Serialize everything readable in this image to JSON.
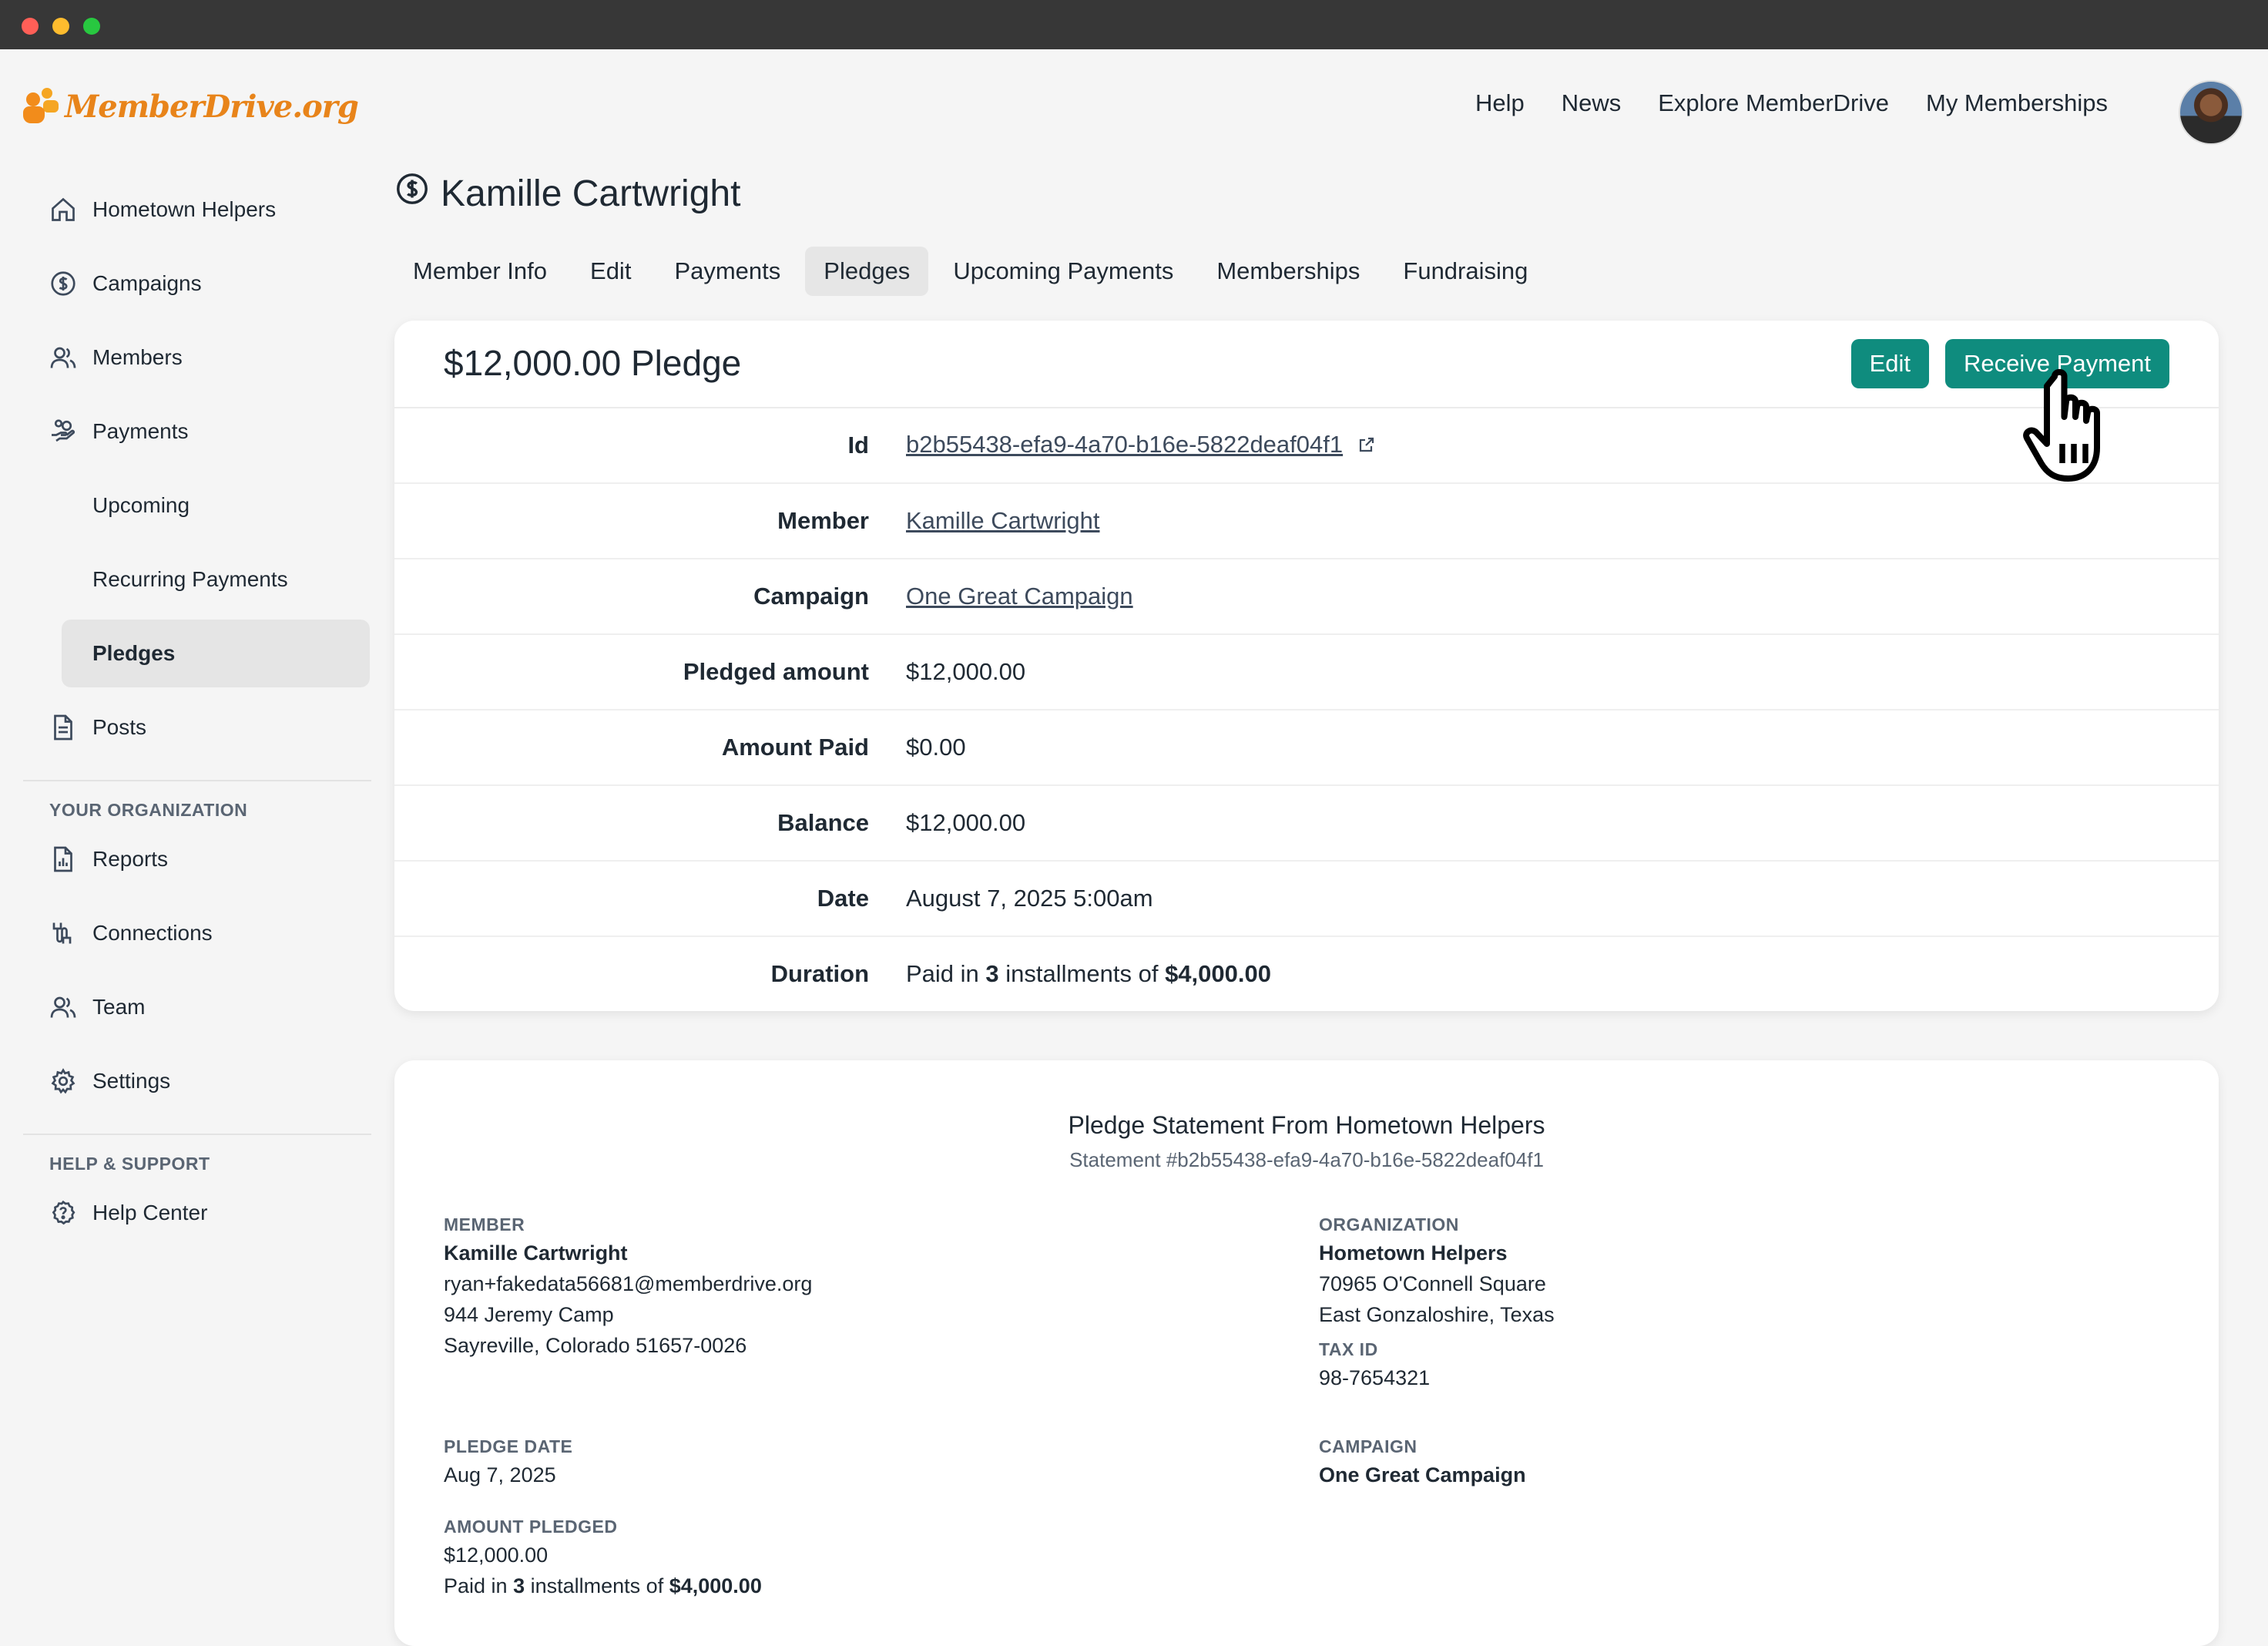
{
  "app": {
    "logo_text": "MemberDrive.org"
  },
  "topnav": {
    "items": [
      "Help",
      "News",
      "Explore MemberDrive",
      "My Memberships"
    ]
  },
  "sidebar": {
    "items": [
      {
        "label": "Hometown Helpers",
        "icon": "home-icon"
      },
      {
        "label": "Campaigns",
        "icon": "dollar-circle-icon"
      },
      {
        "label": "Members",
        "icon": "users-icon"
      },
      {
        "label": "Payments",
        "icon": "hand-coins-icon"
      },
      {
        "label": "Upcoming"
      },
      {
        "label": "Recurring Payments"
      },
      {
        "label": "Pledges"
      },
      {
        "label": "Posts",
        "icon": "document-icon"
      }
    ],
    "org_heading": "YOUR ORGANIZATION",
    "org_items": [
      {
        "label": "Reports",
        "icon": "report-icon"
      },
      {
        "label": "Connections",
        "icon": "connections-icon"
      },
      {
        "label": "Team",
        "icon": "team-icon"
      },
      {
        "label": "Settings",
        "icon": "gear-icon"
      }
    ],
    "help_heading": "HELP & SUPPORT",
    "help_items": [
      {
        "label": "Help Center",
        "icon": "question-circle-icon"
      }
    ]
  },
  "page": {
    "title": "Kamille Cartwright"
  },
  "tabs": [
    "Member Info",
    "Edit",
    "Payments",
    "Pledges",
    "Upcoming Payments",
    "Memberships",
    "Fundraising"
  ],
  "pledge": {
    "title": "$12,000.00 Pledge",
    "edit_label": "Edit",
    "receive_label": "Receive Payment",
    "fields": {
      "id_label": "Id",
      "id": "b2b55438-efa9-4a70-b16e-5822deaf04f1",
      "member_label": "Member",
      "member": "Kamille Cartwright",
      "campaign_label": "Campaign",
      "campaign": "One Great Campaign",
      "pledged_label": "Pledged amount",
      "pledged": "$12,000.00",
      "paid_label": "Amount Paid",
      "paid": "$0.00",
      "balance_label": "Balance",
      "balance": "$12,000.00",
      "date_label": "Date",
      "date": "August 7, 2025 5:00am",
      "duration_label": "Duration",
      "duration_prefix": "Paid in",
      "duration_count": "3",
      "duration_mid": "installments of",
      "duration_amount": "$4,000.00"
    }
  },
  "statement": {
    "title": "Pledge Statement From Hometown Helpers",
    "subtitle": "Statement #b2b55438-efa9-4a70-b16e-5822deaf04f1",
    "member_heading": "MEMBER",
    "member_name": "Kamille Cartwright",
    "member_email": "ryan+fakedata56681@memberdrive.org",
    "member_addr1": "944 Jeremy Camp",
    "member_addr2": "Sayreville, Colorado 51657-0026",
    "org_heading": "ORGANIZATION",
    "org_name": "Hometown Helpers",
    "org_addr1": "70965 O'Connell Square",
    "org_addr2": "East Gonzaloshire, Texas",
    "tax_heading": "TAX ID",
    "tax_id": "98-7654321",
    "pledge_date_heading": "PLEDGE DATE",
    "pledge_date": "Aug 7, 2025",
    "campaign_heading": "CAMPAIGN",
    "campaign": "One Great Campaign",
    "amount_heading": "AMOUNT PLEDGED",
    "amount": "$12,000.00",
    "paid_prefix": "Paid in",
    "paid_count": "3",
    "paid_mid": "installments of",
    "paid_amount": "$4,000.00"
  },
  "colors": {
    "accent": "#0f8c7e",
    "brand": "#e8841a"
  }
}
